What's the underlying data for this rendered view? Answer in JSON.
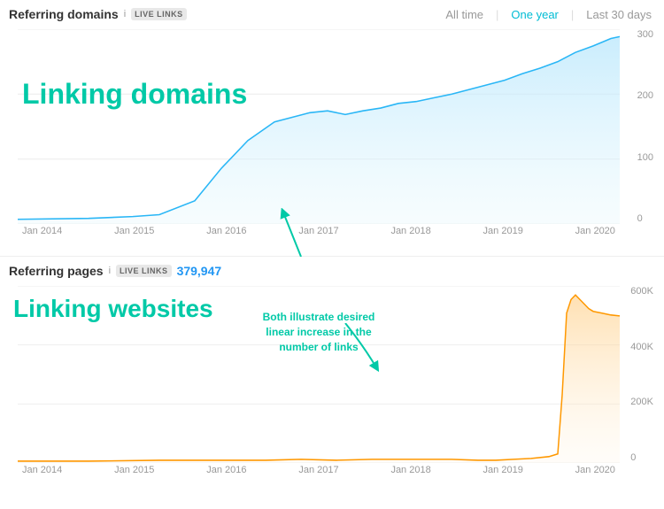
{
  "header": {
    "title": "Referring domains",
    "badge": "LIVE LINKS",
    "info_icon": "i"
  },
  "time_filters": [
    {
      "label": "All time",
      "active": false
    },
    {
      "label": "One year",
      "active": true
    },
    {
      "label": "Last 30 days",
      "active": false
    }
  ],
  "top_chart": {
    "big_label": "Linking domains",
    "y_axis": [
      "300",
      "200",
      "100",
      "0"
    ],
    "x_axis": [
      "Jan 2014",
      "Jan 2015",
      "Jan 2016",
      "Jan 2017",
      "Jan 2018",
      "Jan 2019",
      "Jan 2020"
    ]
  },
  "bottom_section": {
    "title": "Referring pages",
    "badge": "LIVE LINKS",
    "count": "379,947",
    "big_label": "Linking websites",
    "annotation": "Both illustrate desired linear increase in the number of links",
    "y_axis": [
      "600K",
      "400K",
      "200K",
      "0"
    ],
    "x_axis": [
      "Jan 2014",
      "Jan 2015",
      "Jan 2016",
      "Jan 2017",
      "Jan 2018",
      "Jan 2019",
      "Jan 2020"
    ]
  }
}
